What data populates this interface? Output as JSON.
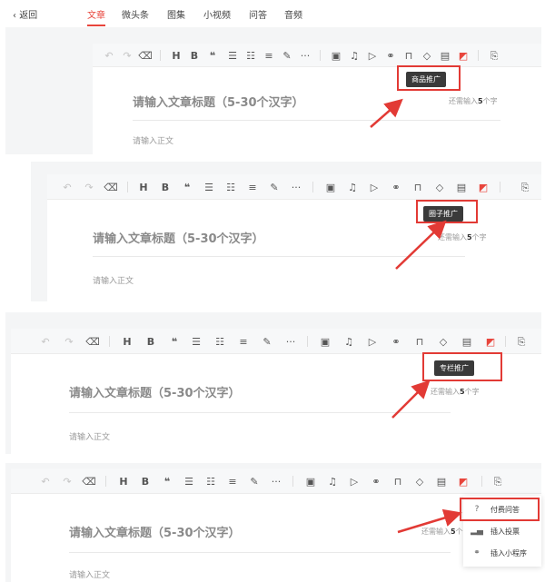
{
  "nav": {
    "back_label": "返回",
    "tabs": [
      "文章",
      "微头条",
      "图集",
      "小视频",
      "问答",
      "音频"
    ],
    "active_tab": "文章"
  },
  "editor": {
    "title_placeholder": "请输入文章标题（5-30个汉字）",
    "counter_prefix": "还需输入",
    "counter_number": "5",
    "counter_suffix": "个字",
    "body_placeholder": "请输入正文"
  },
  "toolbar": {
    "undo_icon": "undo-icon",
    "redo_icon": "redo-icon",
    "clear_icon": "eraser-icon",
    "heading_label": "H",
    "bold_label": "B",
    "quote_label": "❝",
    "more_label": "···"
  },
  "tooltips": {
    "panel1": "商品推广",
    "panel2": "圈子推广",
    "panel3": "专栏推广"
  },
  "dropdown": {
    "items": [
      {
        "label": "付费问答",
        "icon": "question-icon"
      },
      {
        "label": "插入投票",
        "icon": "bar-chart-icon"
      },
      {
        "label": "插入小程序",
        "icon": "link-icon"
      }
    ]
  },
  "colors": {
    "accent": "#e8453c",
    "highlight_box": "#e23a35",
    "tooltip_bg": "#3a3a3a"
  }
}
